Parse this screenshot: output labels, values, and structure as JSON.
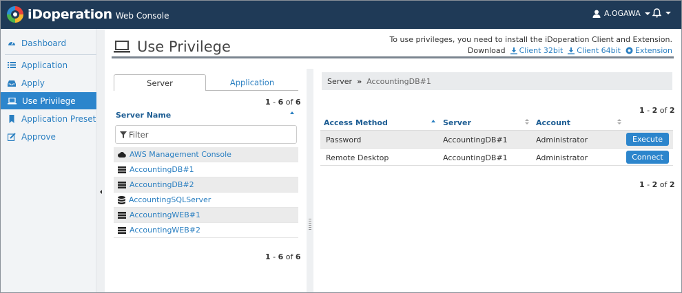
{
  "app": {
    "logo_text": "iDoperation",
    "logo_sub": "Web Console"
  },
  "header": {
    "user": "A.OGAWA"
  },
  "sidebar": {
    "items": [
      {
        "label": "Dashboard",
        "icon": "dashboard-icon"
      },
      {
        "label": "Application",
        "icon": "list-icon"
      },
      {
        "label": "Apply",
        "icon": "inbox-icon"
      },
      {
        "label": "Use Privilege",
        "icon": "laptop-icon",
        "active": true
      },
      {
        "label": "Application Preset",
        "icon": "bookmark-icon"
      },
      {
        "label": "Approve",
        "icon": "edit-icon"
      }
    ]
  },
  "page": {
    "title": "Use Privilege",
    "notice": "To use privileges, you need to install the iDoperation Client and Extension.",
    "download_label": "Download",
    "downloads": [
      "Client 32bit",
      "Client 64bit",
      "Extension"
    ]
  },
  "server_panel": {
    "tabs": [
      "Server",
      "Application"
    ],
    "pager": {
      "from": "1",
      "dash": "-",
      "to": "6",
      "of": "of",
      "total": "6"
    },
    "column": "Server Name",
    "filter_placeholder": "Filter",
    "rows": [
      {
        "name": "AWS Management Console",
        "icon": "cloud-icon"
      },
      {
        "name": "AccountingDB#1",
        "icon": "server-icon"
      },
      {
        "name": "AccountingDB#2",
        "icon": "server-icon"
      },
      {
        "name": "AccountingSQLServer",
        "icon": "database-icon"
      },
      {
        "name": "AccountingWEB#1",
        "icon": "server-icon"
      },
      {
        "name": "AccountingWEB#2",
        "icon": "server-icon"
      }
    ]
  },
  "method_panel": {
    "breadcrumb": {
      "root": "Server",
      "current": "AccountingDB#1"
    },
    "pager": {
      "from": "1",
      "dash": "-",
      "to": "2",
      "of": "of",
      "total": "2"
    },
    "columns": [
      "Access Method",
      "Server",
      "Account"
    ],
    "rows": [
      {
        "method": "Password",
        "server": "AccountingDB#1",
        "account": "Administrator",
        "action": "Execute"
      },
      {
        "method": "Remote Desktop",
        "server": "AccountingDB#1",
        "account": "Administrator",
        "action": "Connect"
      }
    ]
  },
  "colors": {
    "topbar": "#1f3a57",
    "accent": "#2c85cc",
    "link": "#2a7fc1"
  }
}
